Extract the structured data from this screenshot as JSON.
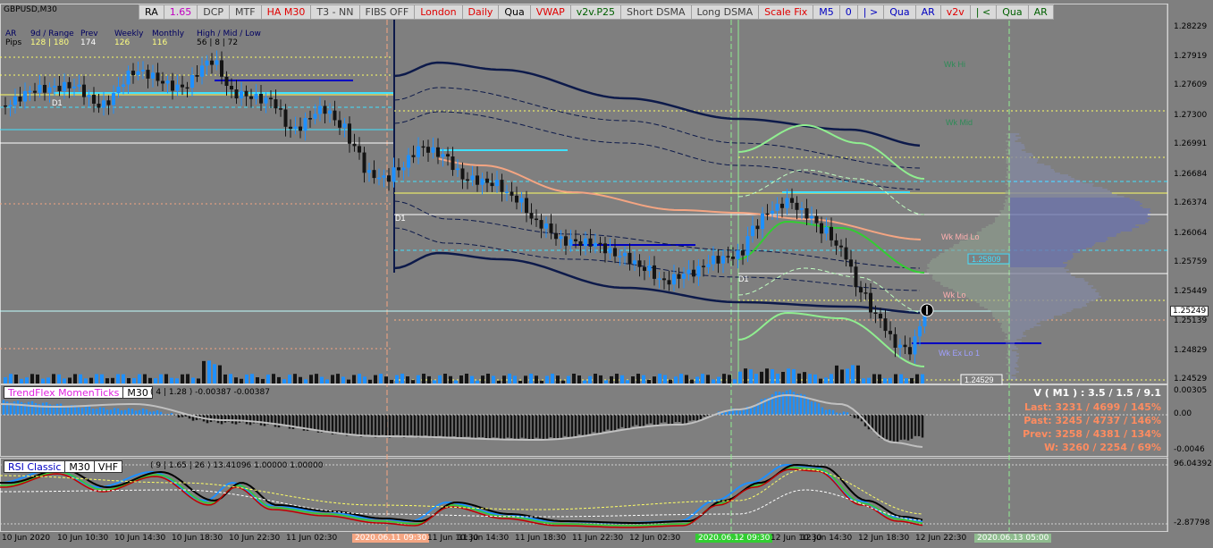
{
  "symbol": "GBPUSD,M30",
  "toolbar": [
    {
      "label": "RA",
      "color": "#000000"
    },
    {
      "label": "1.65",
      "color": "#c000c0"
    },
    {
      "label": "DCP",
      "color": "#404040"
    },
    {
      "label": "MTF",
      "color": "#404040"
    },
    {
      "label": "HA M30",
      "color": "#e00000"
    },
    {
      "label": "T3 - NN",
      "color": "#404040"
    },
    {
      "label": "FIBS OFF",
      "color": "#404040"
    },
    {
      "label": "London",
      "color": "#e00000"
    },
    {
      "label": "Daily",
      "color": "#e00000"
    },
    {
      "label": "Qua",
      "color": "#000000"
    },
    {
      "label": "VWAP",
      "color": "#e00000"
    },
    {
      "label": "v2v.P25",
      "color": "#006000"
    },
    {
      "label": "Short DSMA",
      "color": "#404040"
    },
    {
      "label": "Long DSMA",
      "color": "#404040"
    },
    {
      "label": "Scale Fix",
      "color": "#e00000"
    },
    {
      "label": "M5",
      "color": "#0000c0"
    },
    {
      "label": "0",
      "color": "#0000c0"
    },
    {
      "label": "| >",
      "color": "#0000c0"
    },
    {
      "label": "Qua",
      "color": "#0000c0"
    },
    {
      "label": "AR",
      "color": "#0000c0"
    },
    {
      "label": "v2v",
      "color": "#e00000"
    },
    {
      "label": "| <",
      "color": "#006000"
    },
    {
      "label": "Qua",
      "color": "#006000"
    },
    {
      "label": "AR",
      "color": "#006000"
    }
  ],
  "info": {
    "row1": [
      "AR",
      "9d / Range",
      "Prev",
      "Weekly",
      "Monthly",
      "High / Mid / Low"
    ],
    "row2": [
      "Pips",
      "128 | 180",
      "174",
      "126",
      "116",
      "56 | 8 | 72"
    ]
  },
  "price_axis": [
    "1.28229",
    "1.27919",
    "1.27609",
    "1.27300",
    "1.26991",
    "1.26684",
    "1.26374",
    "1.26064",
    "1.25759",
    "1.25449",
    "1.25249",
    "1.25139",
    "1.24829",
    "1.24529"
  ],
  "price_tags": {
    "current": "1.25249",
    "box1": "1.25809",
    "box2": "1.24529"
  },
  "level_labels": [
    "D1",
    "D1",
    "D1",
    "Wk Hi",
    "Wk Mid",
    "Wk Mid Lo",
    "Wk Lo",
    "Wk Ex Lo 1"
  ],
  "indicator1": {
    "name": "TrendFlex MomenTicks",
    "tf": "M30",
    "params": "( 4 | 1.28 ) -0.00387 -0.00387",
    "axis": [
      "0.00305",
      "0.00",
      "-0.0046"
    ]
  },
  "stats": {
    "title": "V ( M1 ) : 3.5 / 1.5 / 9.1",
    "last": "Last: 3231 / 4699 / 145%",
    "past": "Past: 3245 / 4737 / 146%",
    "prev": "Prev: 3258 / 4381 / 134%",
    "w": "W: 3260 / 2254 / 69%"
  },
  "indicator2": {
    "name": "RSI Classic",
    "tf": "M30",
    "extra": "VHF",
    "params": "( 9 | 1.65 | 26 ) 13.41096 1.00000 1.00000",
    "axis": [
      "96.04392",
      "-2.87798"
    ]
  },
  "time_axis": [
    "10 Jun 2020",
    "10 Jun 10:30",
    "10 Jun 14:30",
    "10 Jun 18:30",
    "10 Jun 22:30",
    "11 Jun 02:30",
    "11 Jun 06:30",
    "2020.06.11 09:30",
    "11 Jun 10:30",
    "11 Jun 14:30",
    "11 Jun 18:30",
    "11 Jun 22:30",
    "12 Jun 02:30",
    "12 Jun 06:30",
    "2020.06.12 09:30",
    "12 Jun 10:30",
    "12 Jun 14:30",
    "12 Jun 18:30",
    "12 Jun 22:30",
    "2020.06.13 05:00"
  ],
  "colors": {
    "bg": "#7f7f7f",
    "bull": "#1e90ff",
    "bear": "#141414",
    "vwap": "#f4a582",
    "band": "#0d1a4a",
    "green": "#32cd32",
    "lime": "#90ee90",
    "cyan": "#40e0ff",
    "yellow": "#ffff66"
  }
}
